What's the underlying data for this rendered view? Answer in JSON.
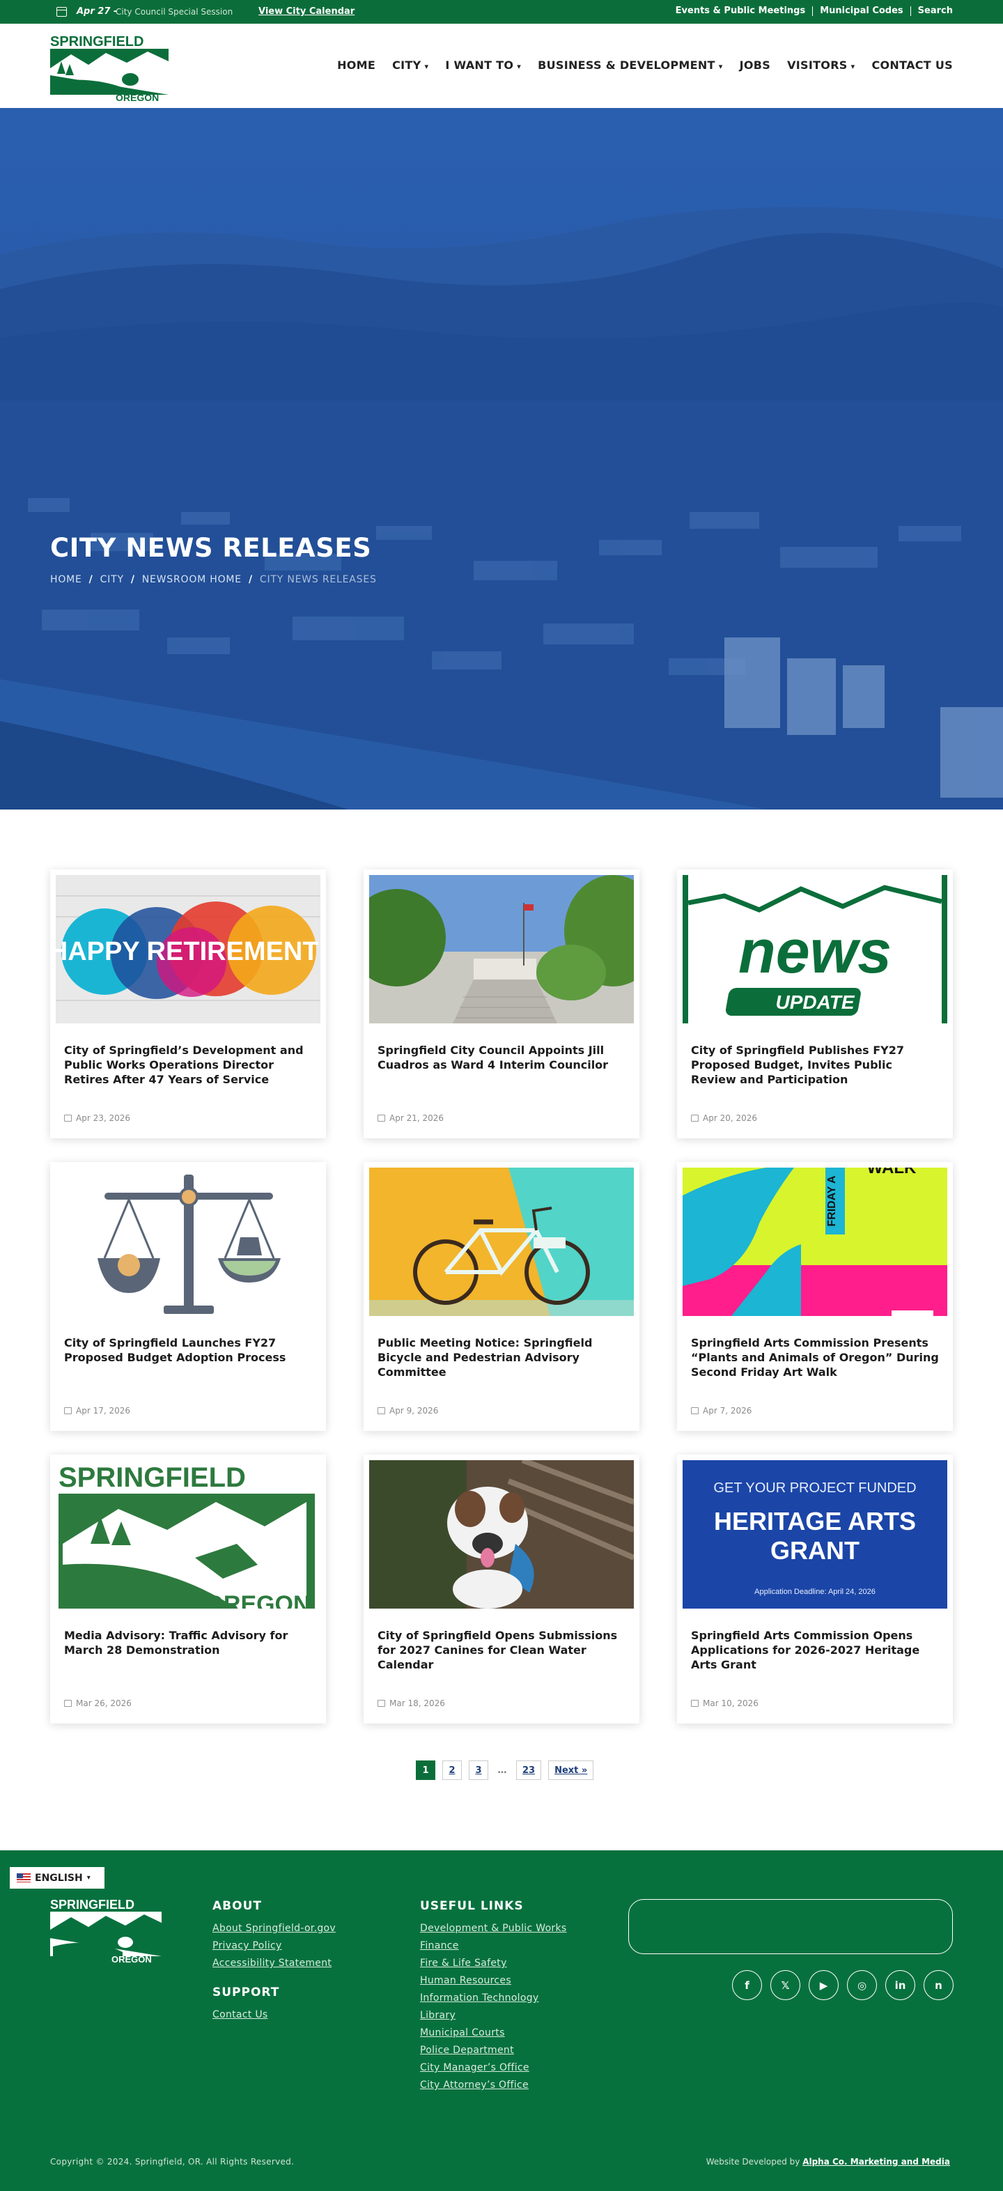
{
  "topbar": {
    "event_date": "Apr 27 -",
    "event_name": "City Council Special Session",
    "view_calendar": "View City Calendar",
    "util_links": [
      "Events & Public Meetings",
      "Municipal Codes",
      "Search"
    ]
  },
  "header": {
    "logo_text_top": "SPRINGFIELD",
    "logo_text_bottom": "OREGON",
    "nav": [
      {
        "label": "HOME",
        "dropdown": false
      },
      {
        "label": "CITY",
        "dropdown": true
      },
      {
        "label": "I WANT TO",
        "dropdown": true
      },
      {
        "label": "BUSINESS & DEVELOPMENT",
        "dropdown": true
      },
      {
        "label": "JOBS",
        "dropdown": false
      },
      {
        "label": "VISITORS",
        "dropdown": true
      },
      {
        "label": "CONTACT US",
        "dropdown": false
      }
    ]
  },
  "hero": {
    "title": "CITY NEWS RELEASES",
    "breadcrumbs": [
      "HOME",
      "CITY",
      "NEWSROOM HOME",
      "CITY NEWS RELEASES"
    ]
  },
  "cards": [
    {
      "title": "City of Springfield’s Development and Public Works Operations Director Retires After 47 Years of Service",
      "date": "Apr 23, 2026",
      "image": "retirement-banner",
      "image_text": "HAPPY RETIREMENT!"
    },
    {
      "title": "Springfield City Council Appoints Jill Cuadros as Ward 4 Interim Councilor",
      "date": "Apr 21, 2026",
      "image": "city-hall-photo"
    },
    {
      "title": "City of Springfield Publishes FY27 Proposed Budget, Invites Public Review and Participation",
      "date": "Apr 20, 2026",
      "image": "news-update-graphic",
      "image_text": "news",
      "image_text2": "UPDATE"
    },
    {
      "title": "City of Springfield Launches FY27 Proposed Budget Adoption Process",
      "date": "Apr 17, 2026",
      "image": "balance-scale-icon"
    },
    {
      "title": "Public Meeting Notice: Springfield Bicycle and Pedestrian Advisory Committee",
      "date": "Apr 9, 2026",
      "image": "bicycle-illustration"
    },
    {
      "title": "Springfield Arts Commission Presents “Plants and Animals of Oregon” During Second Friday Art Walk",
      "date": "Apr 7, 2026",
      "image": "art-walk-graphic",
      "image_text": "FRIDAY A",
      "image_text2": "WALK"
    },
    {
      "title": "Media Advisory: Traffic Advisory for March 28 Demonstration",
      "date": "Mar 26, 2026",
      "image": "springfield-logo",
      "image_text": "SPRINGFIELD",
      "image_text2": "OREGON"
    },
    {
      "title": "City of Springfield Opens Submissions for 2027 Canines for Clean Water Calendar",
      "date": "Mar 18, 2026",
      "image": "dog-photo"
    },
    {
      "title": "Springfield Arts Commission Opens Applications for 2026-2027 Heritage Arts Grant",
      "date": "Mar 10, 2026",
      "image": "heritage-grant-graphic",
      "image_text": "GET YOUR PROJECT FUNDED",
      "image_text2": "HERITAGE ARTS GRANT",
      "image_text3": "Application Deadline: April 24, 2026"
    }
  ],
  "pagination": {
    "pages": [
      "1",
      "2",
      "3"
    ],
    "ellipsis": "…",
    "last": "23",
    "next": "Next »",
    "current": "1"
  },
  "footer": {
    "language": "ENGLISH",
    "about": {
      "heading": "ABOUT",
      "links": [
        "About Springfield-or.gov",
        "Privacy Policy",
        "Accessibility Statement"
      ]
    },
    "support": {
      "heading": "SUPPORT",
      "links": [
        "Contact Us"
      ]
    },
    "useful": {
      "heading": "USEFUL LINKS",
      "links": [
        "Development & Public Works",
        "Finance",
        "Fire & Life Safety",
        "Human Resources",
        "Information Technology",
        "Library",
        "Municipal Courts",
        "Police Department",
        "City Manager’s Office",
        "City Attorney’s Office"
      ]
    },
    "social_icons": [
      "facebook-icon",
      "x-icon",
      "youtube-icon",
      "instagram-icon",
      "linkedin-icon",
      "nextdoor-icon"
    ],
    "copyright": "Copyright © 2024. Springfield, OR. All Rights Reserved.",
    "developed_by_prefix": "Website Developed by",
    "developed_by": "Alpha Co. Marketing and Media"
  },
  "colors": {
    "brand_green": "#0b6e3a",
    "hero_blue": "#1d4f9c",
    "link_blue": "#1e3f7a"
  }
}
